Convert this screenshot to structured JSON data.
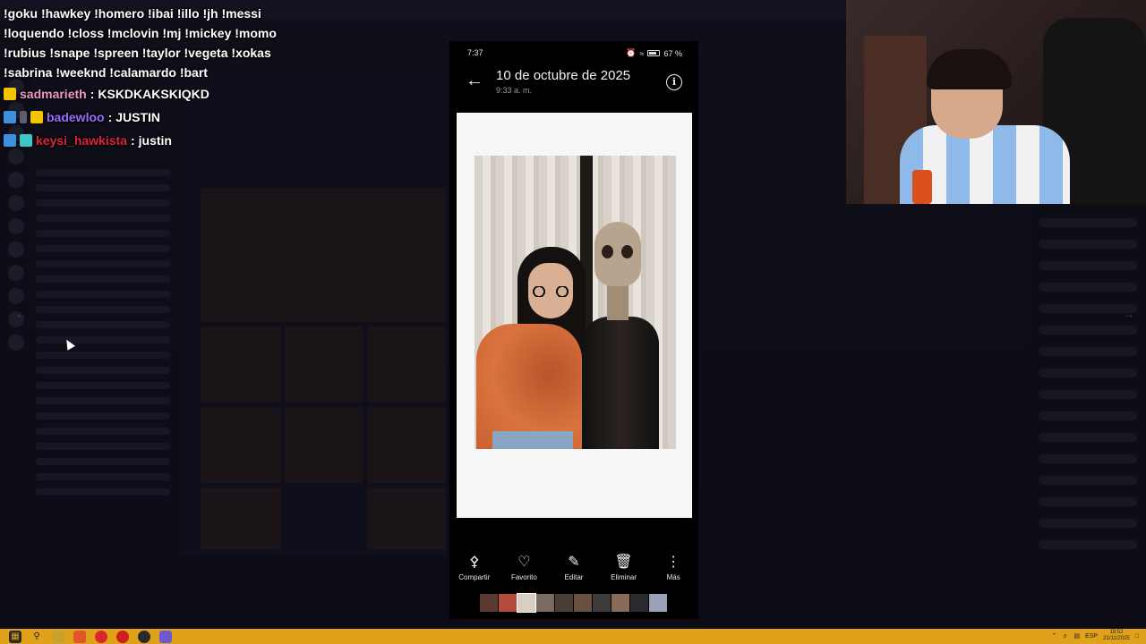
{
  "chat": {
    "commands": [
      "!goku !hawkey !homero !ibai !illo !jh !messi",
      "!loquendo !closs !mclovin !mj !mickey !momo",
      "!rubius !snape !spreen !taylor !vegeta !xokas",
      "!sabrina !weeknd !calamardo !bart"
    ],
    "messages": [
      {
        "user": "sadmarieth",
        "text": "KSKDKAKSKIQKD",
        "user_color": "#f09cc0"
      },
      {
        "user": "badewloo",
        "text": "JUSTIN",
        "user_color": "#9b6bff"
      },
      {
        "user": "keysi_hawkista",
        "text": "justin",
        "user_color": "#e0223a"
      }
    ],
    "separator": ":"
  },
  "phone": {
    "status_time": "7:37",
    "battery": "67 %",
    "header": {
      "date": "10 de octubre de 2025",
      "time": "9:33 a. m."
    },
    "actions": [
      {
        "label": "Compartir",
        "icon": "share-icon"
      },
      {
        "label": "Favorito",
        "icon": "heart-icon"
      },
      {
        "label": "Editar",
        "icon": "edit-icon"
      },
      {
        "label": "Eliminar",
        "icon": "trash-icon"
      },
      {
        "label": "Más",
        "icon": "more-icon"
      }
    ]
  },
  "taskbar": {
    "lang": "ESP",
    "clock_time": "19:52",
    "clock_date": "21/11/2025"
  },
  "colors": {
    "taskbar": "#e0a21a",
    "background": "#0b0b14"
  }
}
